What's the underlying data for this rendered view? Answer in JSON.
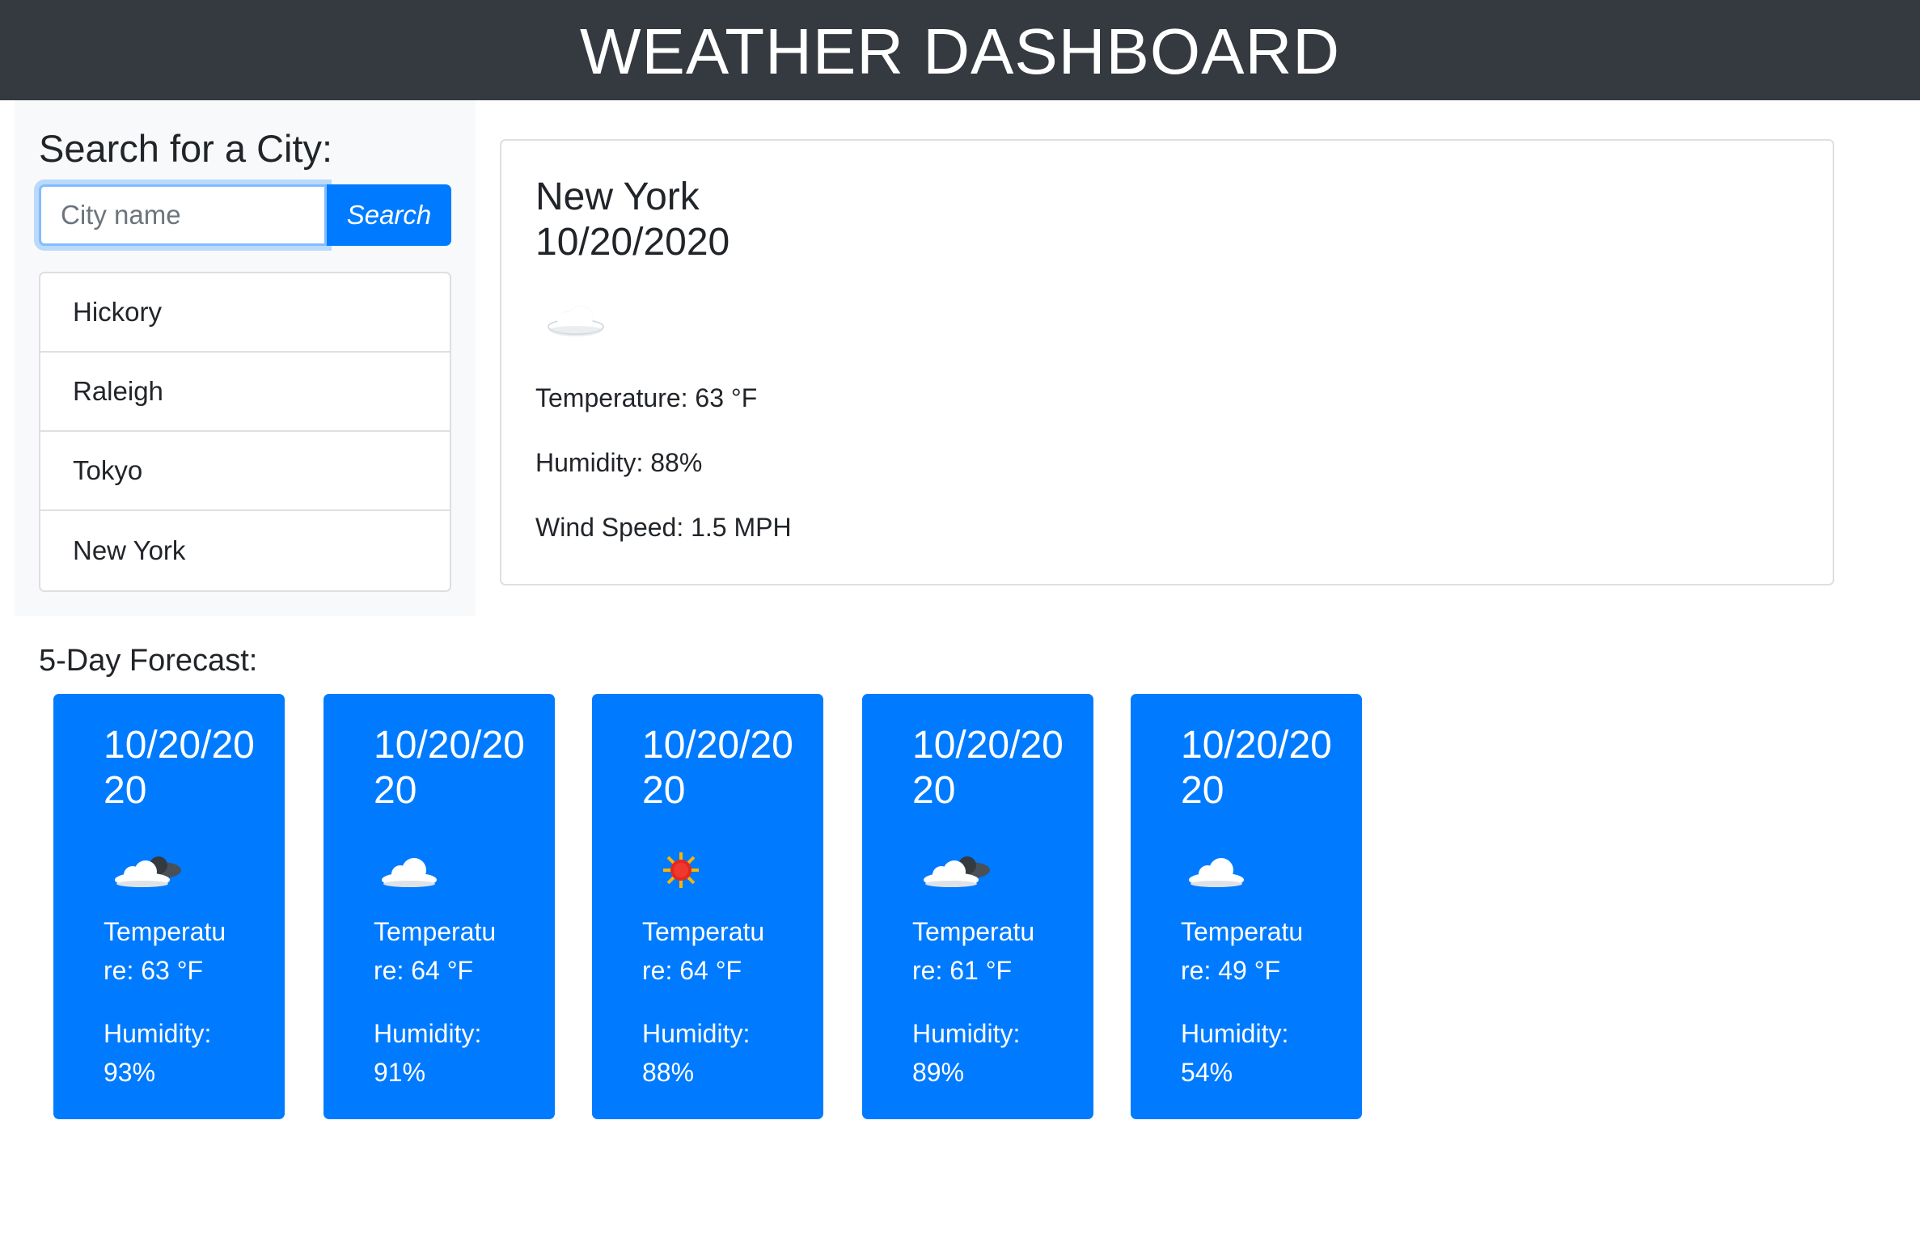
{
  "header": {
    "title": "WEATHER DASHBOARD"
  },
  "search": {
    "heading": "Search for a City:",
    "placeholder": "City name",
    "value": "",
    "button_label": "Search"
  },
  "history": [
    "Hickory",
    "Raleigh",
    "Tokyo",
    "New York"
  ],
  "current": {
    "city": "New York",
    "date": "10/20/2020",
    "icon": "cloud-icon",
    "temperature": "Temperature: 63 °F",
    "humidity": "Humidity: 88%",
    "wind": "Wind Speed: 1.5 MPH"
  },
  "forecast": {
    "title": "5-Day Forecast:",
    "days": [
      {
        "date": "10/20/2020",
        "icon": "partly-cloudy-icon",
        "temperature": "Temperature: 63 °F",
        "humidity": "Humidity: 93%"
      },
      {
        "date": "10/20/2020",
        "icon": "cloud-icon",
        "temperature": "Temperature: 64 °F",
        "humidity": "Humidity: 91%"
      },
      {
        "date": "10/20/2020",
        "icon": "sun-icon",
        "temperature": "Temperature: 64 °F",
        "humidity": "Humidity: 88%"
      },
      {
        "date": "10/20/2020",
        "icon": "partly-cloudy-icon",
        "temperature": "Temperature: 61 °F",
        "humidity": "Humidity: 89%"
      },
      {
        "date": "10/20/2020",
        "icon": "cloud-icon",
        "temperature": "Temperature: 49 °F",
        "humidity": "Humidity: 54%"
      }
    ]
  },
  "colors": {
    "header_bg": "#343a40",
    "accent": "#007bff",
    "sidebar_bg": "#f8f9fa"
  }
}
